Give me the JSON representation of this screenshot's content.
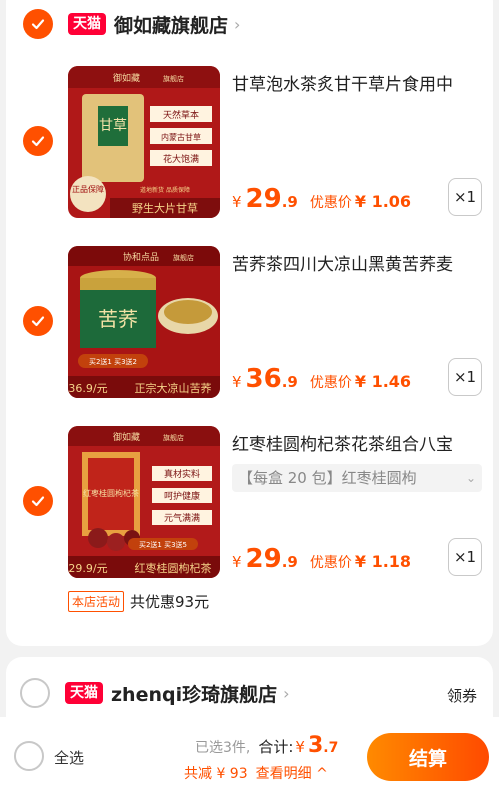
{
  "colors": {
    "accent": "#ff5000",
    "tmall_red": "#ff0036",
    "page_bg": "#f2f2f2"
  },
  "store1": {
    "badge": "天猫",
    "name": "御如藏旗舰店",
    "checked": true,
    "items": [
      {
        "title": "甘草泡水茶炙甘干草片食用中",
        "thumb_brand": "御如藏",
        "thumb_shop": "旗舰店",
        "thumb_tags": [
          "天然草本",
          "内蒙古甘草",
          "花大饱满"
        ],
        "thumb_jar": "甘草",
        "thumb_seal": "正品保障",
        "thumb_footer": "野生大片甘草",
        "thumb_sub": "道地新货  品质保障",
        "price_currency": "¥",
        "price_int": "29",
        "price_dec": ".9",
        "coupon_label": "优惠价",
        "coupon_price": "¥ 1.06",
        "qty": "×1"
      },
      {
        "title": "苦荞茶四川大凉山黑黄苦荞麦",
        "thumb_brand": "协和点品",
        "thumb_shop": "旗舰店",
        "thumb_jar": "苦荞",
        "thumb_promo": "买2送1 买3送2",
        "thumb_price": "36.9/元",
        "thumb_footer": "正宗大凉山苦荞",
        "price_currency": "¥",
        "price_int": "36",
        "price_dec": ".9",
        "coupon_label": "优惠价",
        "coupon_price": "¥ 1.46",
        "qty": "×1"
      },
      {
        "title": "红枣桂圆枸杞茶花茶组合八宝",
        "sku": "【每盒 20 包】红枣桂圆枸",
        "thumb_brand": "御如藏",
        "thumb_shop": "旗舰店",
        "thumb_tags": [
          "真材实料",
          "呵护健康",
          "元气满满"
        ],
        "thumb_box": "红枣桂圆枸杞茶",
        "thumb_promo": "买2送1 买3送5",
        "thumb_price": "29.9/元",
        "thumb_footer": "红枣桂圆枸杞茶",
        "price_currency": "¥",
        "price_int": "29",
        "price_dec": ".9",
        "coupon_label": "优惠价",
        "coupon_price": "¥ 1.18",
        "qty": "×1"
      }
    ],
    "activity_tag": "本店活动",
    "activity_text": "共优惠93元"
  },
  "store2": {
    "badge": "天猫",
    "name": "zhenqi珍琦旗舰店",
    "coupon_link": "领券",
    "checked": false
  },
  "bottom": {
    "select_all": "全选",
    "selected_count": "已选3件,",
    "total_label": "合计:",
    "total_currency": "¥",
    "total_int": "3",
    "total_dec": ".7",
    "discount": "共减 ¥ 93",
    "detail_link": "查看明细 ^",
    "checkout": "结算"
  },
  "icons": {
    "check": "checkmark-icon",
    "chevron": "chevron-right-icon",
    "dropdown": "chevron-down-icon"
  }
}
